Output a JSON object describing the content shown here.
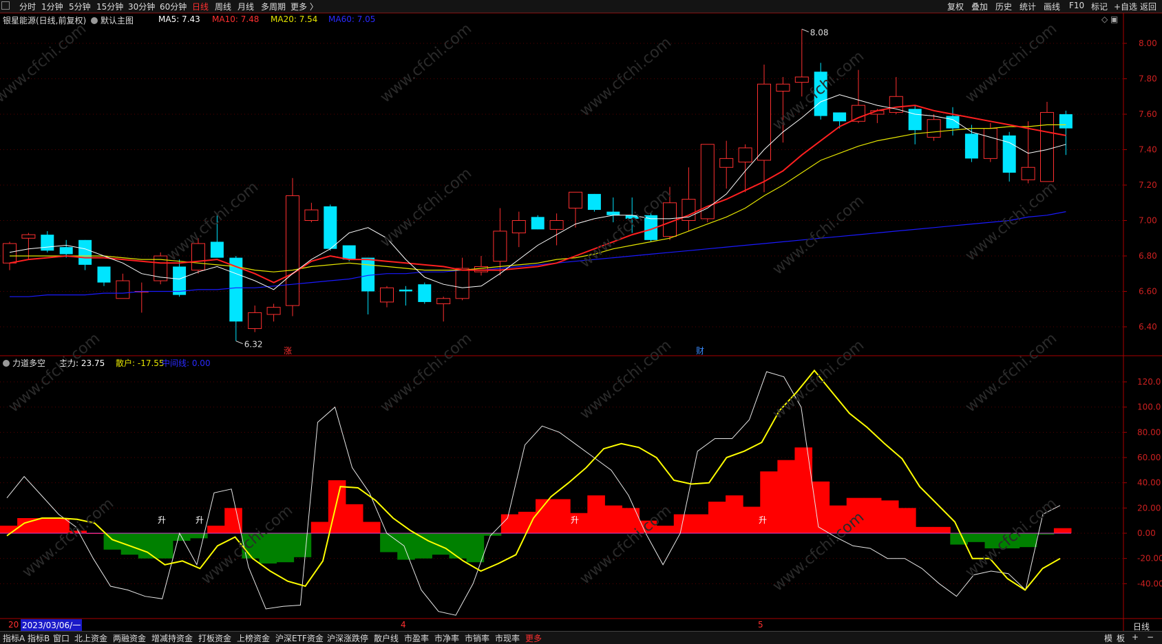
{
  "toolbar": {
    "periods": [
      "分时",
      "1分钟",
      "5分钟",
      "15分钟",
      "30分钟",
      "60分钟",
      "日线",
      "周线",
      "月线",
      "多周期",
      "更多 〉"
    ],
    "active_period": "日线",
    "right_buttons": [
      "复权",
      "叠加",
      "历史",
      "统计",
      "画线",
      "F10",
      "标记",
      "+自选",
      "返回"
    ]
  },
  "main_panel": {
    "title": "银星能源(日线,前复权)",
    "indicator_label": "默认主图",
    "ma5": "MA5: 7.43",
    "ma10": "MA10: 7.48",
    "ma20": "MA20: 7.54",
    "ma60": "MA60: 7.05",
    "high_mark": "8.08",
    "low_mark": "6.32",
    "markers": [
      "涨",
      "财"
    ],
    "price_ticks": [
      "8.00",
      "7.80",
      "7.60",
      "7.40",
      "7.20",
      "7.00",
      "6.80",
      "6.60",
      "6.40"
    ]
  },
  "sub_panel": {
    "title": "力道多空",
    "zhuli": "主力: 23.75",
    "sanhu": "散户: -17.55",
    "zhongjian": "中间线: 0.00",
    "ticks": [
      "120.0",
      "100.0",
      "80.00",
      "60.00",
      "40.00",
      "20.00",
      "0.00",
      "-20.00",
      "-40.00"
    ],
    "rise_label": "升"
  },
  "date_axis": {
    "year_prefix": "20",
    "cursor_date": "2023/03/06/一",
    "months": [
      "4",
      "5"
    ],
    "period_label": "日线"
  },
  "bottom_tabs": [
    "指标A",
    "指标B",
    "窗口",
    "北上资金",
    "两融资金",
    "增减持资金",
    "打板资金",
    "上榜资金",
    "沪深ETF资金",
    "沪深涨跌停",
    "散户线",
    "市盈率",
    "市净率",
    "市销率",
    "市现率",
    "更多"
  ],
  "bottom_right": [
    "模",
    "板",
    "+",
    "−"
  ],
  "watermark": "www.cfchi.com",
  "colors": {
    "up": "#ff3030",
    "down": "#00e5ff",
    "ma5": "#ffffff",
    "ma10": "#ff2020",
    "ma20": "#e6e600",
    "ma60": "#1a1aff",
    "bull": "#ff0000",
    "bear": "#008000"
  },
  "chart_data": [
    {
      "type": "candlestick",
      "title": "银星能源(日线,前复权)",
      "ylim": [
        6.28,
        8.2
      ],
      "candles": [
        {
          "o": 6.76,
          "h": 6.88,
          "l": 6.72,
          "c": 6.87
        },
        {
          "o": 6.9,
          "h": 6.93,
          "l": 6.78,
          "c": 6.92
        },
        {
          "o": 6.92,
          "h": 6.94,
          "l": 6.82,
          "c": 6.83
        },
        {
          "o": 6.85,
          "h": 6.89,
          "l": 6.79,
          "c": 6.81
        },
        {
          "o": 6.89,
          "h": 6.89,
          "l": 6.72,
          "c": 6.75
        },
        {
          "o": 6.74,
          "h": 6.74,
          "l": 6.63,
          "c": 6.65
        },
        {
          "o": 6.56,
          "h": 6.7,
          "l": 6.56,
          "c": 6.66
        },
        {
          "o": 6.6,
          "h": 6.65,
          "l": 6.48,
          "c": 6.6
        },
        {
          "o": 6.66,
          "h": 6.82,
          "l": 6.64,
          "c": 6.8
        },
        {
          "o": 6.74,
          "h": 6.78,
          "l": 6.57,
          "c": 6.58
        },
        {
          "o": 6.72,
          "h": 6.9,
          "l": 6.7,
          "c": 6.87
        },
        {
          "o": 6.88,
          "h": 7.03,
          "l": 6.8,
          "c": 6.79
        },
        {
          "o": 6.79,
          "h": 6.8,
          "l": 6.32,
          "c": 6.43
        },
        {
          "o": 6.39,
          "h": 6.52,
          "l": 6.37,
          "c": 6.48
        },
        {
          "o": 6.47,
          "h": 6.53,
          "l": 6.43,
          "c": 6.51
        },
        {
          "o": 6.52,
          "h": 7.24,
          "l": 6.46,
          "c": 7.14
        },
        {
          "o": 7.0,
          "h": 7.1,
          "l": 6.99,
          "c": 7.06
        },
        {
          "o": 7.08,
          "h": 7.09,
          "l": 6.83,
          "c": 6.84
        },
        {
          "o": 6.86,
          "h": 6.86,
          "l": 6.77,
          "c": 6.78
        },
        {
          "o": 6.79,
          "h": 6.79,
          "l": 6.47,
          "c": 6.6
        },
        {
          "o": 6.54,
          "h": 6.63,
          "l": 6.51,
          "c": 6.62
        },
        {
          "o": 6.61,
          "h": 6.63,
          "l": 6.52,
          "c": 6.6
        },
        {
          "o": 6.64,
          "h": 6.65,
          "l": 6.53,
          "c": 6.54
        },
        {
          "o": 6.53,
          "h": 6.57,
          "l": 6.43,
          "c": 6.56
        },
        {
          "o": 6.56,
          "h": 6.79,
          "l": 6.55,
          "c": 6.73
        },
        {
          "o": 6.71,
          "h": 6.8,
          "l": 6.69,
          "c": 6.74
        },
        {
          "o": 6.77,
          "h": 7.07,
          "l": 6.69,
          "c": 6.94
        },
        {
          "o": 6.93,
          "h": 7.05,
          "l": 6.85,
          "c": 7.0
        },
        {
          "o": 7.02,
          "h": 7.03,
          "l": 6.95,
          "c": 6.95
        },
        {
          "o": 6.95,
          "h": 7.04,
          "l": 6.86,
          "c": 7.0
        },
        {
          "o": 7.07,
          "h": 7.09,
          "l": 6.96,
          "c": 7.16
        },
        {
          "o": 7.15,
          "h": 7.15,
          "l": 7.05,
          "c": 7.06
        },
        {
          "o": 7.05,
          "h": 7.13,
          "l": 6.99,
          "c": 7.03
        },
        {
          "o": 7.03,
          "h": 7.13,
          "l": 6.93,
          "c": 7.01
        },
        {
          "o": 7.03,
          "h": 7.04,
          "l": 6.88,
          "c": 6.89
        },
        {
          "o": 6.91,
          "h": 7.19,
          "l": 6.89,
          "c": 7.1
        },
        {
          "o": 7.0,
          "h": 7.3,
          "l": 6.94,
          "c": 7.12
        },
        {
          "o": 7.01,
          "h": 7.43,
          "l": 6.99,
          "c": 7.43
        },
        {
          "o": 7.3,
          "h": 7.45,
          "l": 7.18,
          "c": 7.35
        },
        {
          "o": 7.33,
          "h": 7.43,
          "l": 7.16,
          "c": 7.41
        },
        {
          "o": 7.34,
          "h": 7.88,
          "l": 7.16,
          "c": 7.77
        },
        {
          "o": 7.73,
          "h": 7.81,
          "l": 7.44,
          "c": 7.77
        },
        {
          "o": 7.78,
          "h": 8.08,
          "l": 7.7,
          "c": 7.81
        },
        {
          "o": 7.84,
          "h": 7.89,
          "l": 7.57,
          "c": 7.59
        },
        {
          "o": 7.61,
          "h": 7.61,
          "l": 7.52,
          "c": 7.56
        },
        {
          "o": 7.56,
          "h": 7.85,
          "l": 7.55,
          "c": 7.65
        },
        {
          "o": 7.6,
          "h": 7.63,
          "l": 7.55,
          "c": 7.62
        },
        {
          "o": 7.61,
          "h": 7.81,
          "l": 7.6,
          "c": 7.7
        },
        {
          "o": 7.63,
          "h": 7.65,
          "l": 7.43,
          "c": 7.51
        },
        {
          "o": 7.47,
          "h": 7.6,
          "l": 7.45,
          "c": 7.57
        },
        {
          "o": 7.59,
          "h": 7.64,
          "l": 7.48,
          "c": 7.52
        },
        {
          "o": 7.49,
          "h": 7.54,
          "l": 7.33,
          "c": 7.35
        },
        {
          "o": 7.35,
          "h": 7.55,
          "l": 7.33,
          "c": 7.52
        },
        {
          "o": 7.48,
          "h": 7.5,
          "l": 7.22,
          "c": 7.27
        },
        {
          "o": 7.23,
          "h": 7.56,
          "l": 7.21,
          "c": 7.3
        },
        {
          "o": 7.22,
          "h": 7.67,
          "l": 7.22,
          "c": 7.61
        },
        {
          "o": 7.6,
          "h": 7.62,
          "l": 7.37,
          "c": 7.52
        }
      ],
      "ma5": [
        6.82,
        6.84,
        6.85,
        6.86,
        6.84,
        6.8,
        6.76,
        6.7,
        6.68,
        6.67,
        6.71,
        6.74,
        6.7,
        6.66,
        6.61,
        6.7,
        6.78,
        6.84,
        6.93,
        6.96,
        6.9,
        6.78,
        6.68,
        6.64,
        6.62,
        6.63,
        6.7,
        6.78,
        6.86,
        6.92,
        6.98,
        7.01,
        7.03,
        7.03,
        7.01,
        7.01,
        7.02,
        7.07,
        7.15,
        7.28,
        7.4,
        7.5,
        7.58,
        7.67,
        7.71,
        7.68,
        7.65,
        7.63,
        7.6,
        7.59,
        7.57,
        7.5,
        7.47,
        7.44,
        7.38,
        7.4,
        7.43
      ],
      "ma10": [
        6.76,
        6.78,
        6.79,
        6.8,
        6.79,
        6.79,
        6.78,
        6.77,
        6.76,
        6.76,
        6.77,
        6.78,
        6.74,
        6.7,
        6.65,
        6.7,
        6.77,
        6.8,
        6.78,
        6.78,
        6.77,
        6.76,
        6.75,
        6.74,
        6.72,
        6.72,
        6.72,
        6.73,
        6.74,
        6.76,
        6.8,
        6.84,
        6.88,
        6.92,
        6.95,
        6.99,
        7.03,
        7.08,
        7.12,
        7.17,
        7.22,
        7.28,
        7.37,
        7.45,
        7.53,
        7.58,
        7.62,
        7.64,
        7.65,
        7.62,
        7.6,
        7.58,
        7.56,
        7.54,
        7.52,
        7.5,
        7.48
      ],
      "ma20": [
        6.8,
        6.8,
        6.8,
        6.8,
        6.8,
        6.8,
        6.79,
        6.78,
        6.78,
        6.77,
        6.76,
        6.75,
        6.74,
        6.72,
        6.71,
        6.72,
        6.74,
        6.75,
        6.76,
        6.75,
        6.74,
        6.73,
        6.72,
        6.72,
        6.72,
        6.73,
        6.74,
        6.75,
        6.76,
        6.78,
        6.79,
        6.81,
        6.84,
        6.86,
        6.88,
        6.9,
        6.94,
        6.98,
        7.02,
        7.07,
        7.14,
        7.2,
        7.27,
        7.34,
        7.38,
        7.42,
        7.45,
        7.47,
        7.49,
        7.5,
        7.51,
        7.52,
        7.52,
        7.53,
        7.53,
        7.54,
        7.54
      ],
      "ma60": [
        6.57,
        6.57,
        6.58,
        6.58,
        6.58,
        6.59,
        6.59,
        6.6,
        6.6,
        6.6,
        6.61,
        6.61,
        6.62,
        6.62,
        6.63,
        6.64,
        6.65,
        6.66,
        6.67,
        6.69,
        6.7,
        6.7,
        6.71,
        6.71,
        6.72,
        6.72,
        6.73,
        6.74,
        6.75,
        6.76,
        6.77,
        6.78,
        6.79,
        6.8,
        6.81,
        6.82,
        6.83,
        6.84,
        6.85,
        6.86,
        6.87,
        6.88,
        6.89,
        6.9,
        6.91,
        6.92,
        6.93,
        6.94,
        6.95,
        6.96,
        6.97,
        6.98,
        6.99,
        7.0,
        7.02,
        7.03,
        7.05
      ]
    },
    {
      "type": "bar",
      "title": "力道多空",
      "ylim": [
        -68,
        130
      ],
      "bars": [
        6,
        12,
        12,
        12,
        2,
        0,
        -13,
        -17,
        -20,
        -20,
        -6,
        -4,
        6,
        20,
        -20,
        -24,
        -23,
        -19,
        9,
        42,
        23,
        9,
        -15,
        -21,
        -20,
        -17,
        -20,
        -23,
        -2,
        15,
        17,
        27,
        27,
        16,
        30,
        22,
        20,
        10,
        6,
        15,
        15,
        25,
        30,
        21,
        49,
        58,
        68,
        41,
        22,
        28,
        28,
        26,
        20,
        5,
        5,
        -9,
        -7,
        -12,
        -12,
        -11,
        -1,
        4
      ],
      "zhuli_line": [
        -2,
        8,
        12,
        12,
        11,
        8,
        -5,
        -10,
        -15,
        -25,
        -22,
        -28,
        -10,
        -3,
        -20,
        -30,
        -38,
        -42,
        -22,
        37,
        36,
        26,
        12,
        2,
        -6,
        -12,
        -22,
        -30,
        -24,
        -17,
        12,
        29,
        40,
        52,
        67,
        71,
        68,
        60,
        42,
        39,
        40,
        60,
        65,
        72,
        97,
        112,
        129,
        112,
        95,
        84,
        71,
        59,
        37,
        23,
        9,
        -20,
        -20,
        -36,
        -45,
        -28,
        -20
      ],
      "sanhu_line": [
        28,
        45,
        30,
        15,
        5,
        -20,
        -42,
        -45,
        -50,
        -52,
        0,
        -25,
        32,
        35,
        -27,
        -60,
        -58,
        -57,
        88,
        100,
        52,
        32,
        0,
        -10,
        -45,
        -62,
        -65,
        -40,
        -2,
        12,
        70,
        85,
        80,
        70,
        60,
        50,
        30,
        0,
        -25,
        0,
        65,
        75,
        75,
        90,
        128,
        124,
        100,
        5,
        -3,
        -10,
        -12,
        -20,
        -20,
        -28,
        -40,
        -50,
        -33,
        -30,
        -32,
        -45,
        15,
        22
      ]
    }
  ]
}
